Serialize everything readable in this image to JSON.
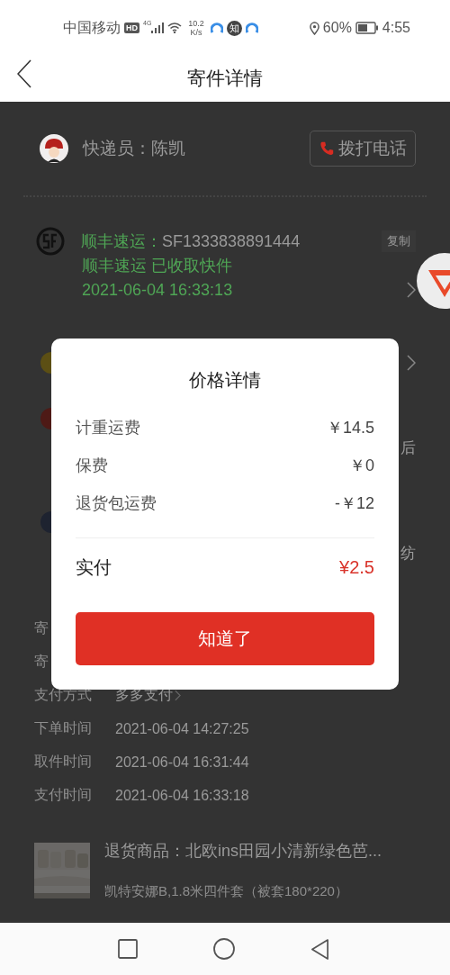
{
  "status_bar": {
    "carrier": "中国移动",
    "hd": "HD",
    "network": "4G",
    "speed": "10.2",
    "speed_unit": "K/s",
    "app_badge": "知",
    "battery": "60%",
    "time": "4:55"
  },
  "header": {
    "title": "寄件详情"
  },
  "courier": {
    "label": "快递员：陈凯",
    "call_button": "拨打电话"
  },
  "shipment": {
    "carrier": "顺丰速运：",
    "tracking_number": "SF1333838891444",
    "copy_button": "复制",
    "status": "顺丰速运 已收取快件",
    "time": "2021-06-04 16:33:13"
  },
  "covered_fragments": [
    {
      "kind": "dot",
      "color": "#5c4f14"
    },
    {
      "kind": "dot",
      "color": "#4e1a16"
    },
    {
      "kind": "text",
      "text": "后"
    },
    {
      "kind": "dot",
      "color": "#1e2330"
    },
    {
      "kind": "text",
      "text": "纺"
    }
  ],
  "order_info": [
    {
      "label": "寄"
    },
    {
      "label": "寄"
    },
    {
      "label": "支付方式",
      "value": "多多支付",
      "link": true
    },
    {
      "label": "下单时间",
      "value": "2021-06-04 14:27:25",
      "link": false
    },
    {
      "label": "取件时间",
      "value": "2021-06-04 16:31:44",
      "link": false
    },
    {
      "label": "支付时间",
      "value": "2021-06-04 16:33:18",
      "link": false
    }
  ],
  "product": {
    "title": "退货商品：北欧ins田园小清新绿色芭...",
    "spec": "凯特安娜B,1.8米四件套（被套180*220）"
  },
  "price_dialog": {
    "title": "价格详情",
    "items": [
      {
        "label": "计重运费",
        "amount": "￥14.5"
      },
      {
        "label": "保费",
        "amount": "￥0"
      },
      {
        "label": "退货包运费",
        "amount": "-￥12"
      }
    ],
    "total_label": "实付",
    "total_amount": "¥2.5",
    "confirm_button": "知道了"
  }
}
